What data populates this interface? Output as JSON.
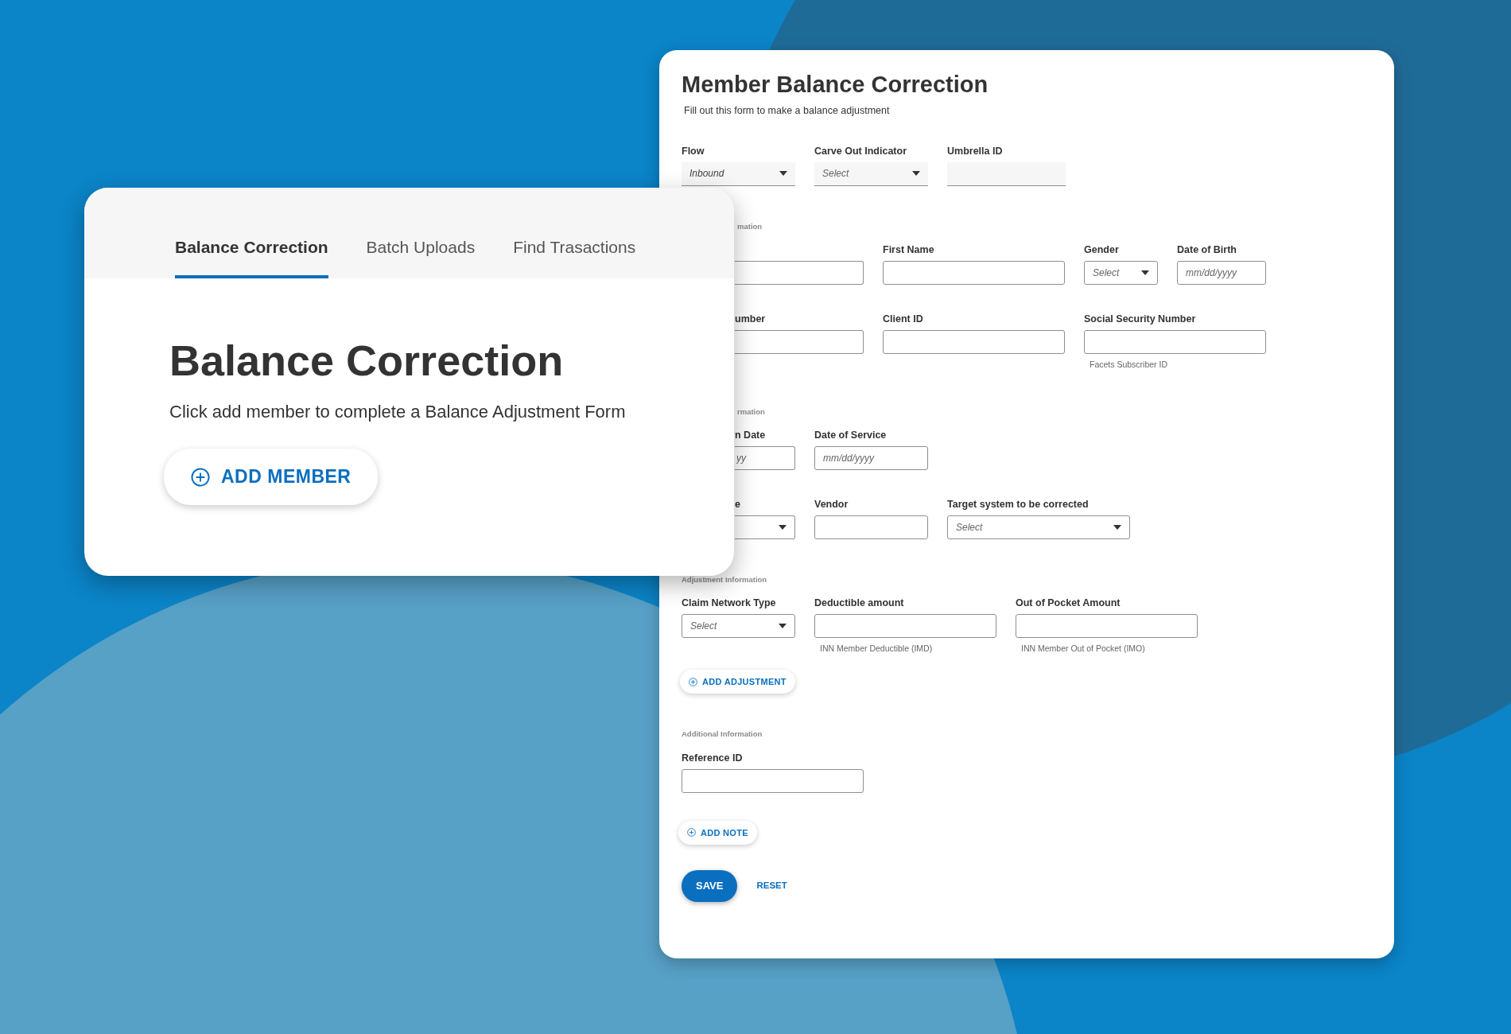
{
  "front_card": {
    "tabs": [
      {
        "label": "Balance Correction",
        "selected": true
      },
      {
        "label": "Batch Uploads",
        "selected": false
      },
      {
        "label": "Find Trasactions",
        "selected": false
      }
    ],
    "heading": "Balance Correction",
    "description": "Click add member to complete a Balance Adjustment Form",
    "button": "ADD MEMBER"
  },
  "form": {
    "title": "Member Balance Correction",
    "subtitle": "Fill out this form to make a balance adjustment",
    "sections": [
      {
        "rows": [
          [
            {
              "label": "Flow",
              "kind": "filled-select",
              "value": "Inbound"
            },
            {
              "label": "Carve Out Indicator",
              "kind": "filled-select",
              "placeholder": "Select"
            },
            {
              "label": "Umbrella ID",
              "kind": "filled-text"
            }
          ]
        ]
      },
      {
        "label": "mation",
        "rows": [
          [
            {
              "kind": "text"
            },
            {
              "label": "First Name",
              "kind": "text"
            },
            {
              "label": "Gender",
              "kind": "select",
              "placeholder": "Select"
            },
            {
              "label": "Date of Birth",
              "kind": "text",
              "placeholder": "mm/dd/yyyy"
            }
          ],
          [
            {
              "label": "umber",
              "kind": "text"
            },
            {
              "label": "Client ID",
              "kind": "text"
            },
            {
              "label": "Social Security Number",
              "kind": "text",
              "helper": "Facets Subscriber ID"
            }
          ]
        ]
      },
      {
        "label": "rmation",
        "rows": [
          [
            {
              "label": "n Date",
              "kind": "text",
              "placeholder": "yy"
            },
            {
              "label": "Date of Service",
              "kind": "text",
              "placeholder": "mm/dd/yyyy"
            }
          ],
          [
            {
              "label": "e",
              "kind": "select"
            },
            {
              "label": "Vendor",
              "kind": "text"
            },
            {
              "label": "Target system to be corrected",
              "kind": "select",
              "placeholder": "Select"
            }
          ]
        ]
      },
      {
        "label": "Adjustment Information",
        "rows": [
          [
            {
              "label": "Claim Network Type",
              "kind": "select",
              "placeholder": "Select"
            },
            {
              "label": "Deductible amount",
              "kind": "text",
              "helper": "INN Member Deductible (IMD)"
            },
            {
              "label": "Out of Pocket Amount",
              "kind": "text",
              "helper": "INN Member Out of Pocket (IMO)"
            }
          ]
        ],
        "button": "ADD ADJUSTMENT"
      },
      {
        "label": "Additional Information",
        "rows": [
          [
            {
              "label": "Reference ID",
              "kind": "text"
            }
          ]
        ],
        "button": "ADD NOTE"
      }
    ],
    "save": "SAVE",
    "reset": "RESET"
  }
}
